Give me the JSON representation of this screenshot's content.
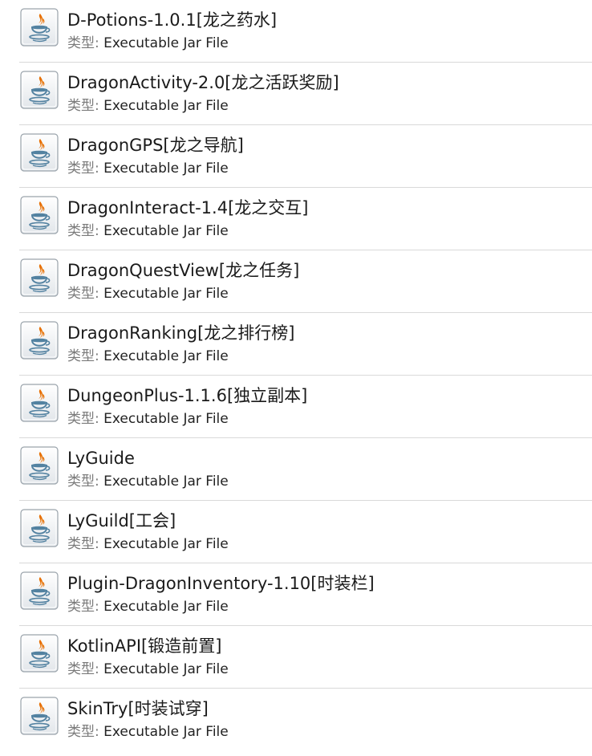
{
  "type_label": "类型:",
  "files": [
    {
      "name": "D-Potions-1.0.1[龙之药水]",
      "type": "Executable Jar File",
      "icon": "java-jar-icon"
    },
    {
      "name": "DragonActivity-2.0[龙之活跃奖励]",
      "type": "Executable Jar File",
      "icon": "java-jar-icon"
    },
    {
      "name": "DragonGPS[龙之导航]",
      "type": "Executable Jar File",
      "icon": "java-jar-icon"
    },
    {
      "name": "DragonInteract-1.4[龙之交互]",
      "type": "Executable Jar File",
      "icon": "java-jar-icon"
    },
    {
      "name": "DragonQuestView[龙之任务]",
      "type": "Executable Jar File",
      "icon": "java-jar-icon"
    },
    {
      "name": "DragonRanking[龙之排行榜]",
      "type": "Executable Jar File",
      "icon": "java-jar-icon"
    },
    {
      "name": "DungeonPlus-1.1.6[独立副本]",
      "type": "Executable Jar File",
      "icon": "java-jar-icon"
    },
    {
      "name": "LyGuide",
      "type": "Executable Jar File",
      "icon": "java-jar-icon"
    },
    {
      "name": "LyGuild[工会]",
      "type": "Executable Jar File",
      "icon": "java-jar-icon"
    },
    {
      "name": "Plugin-DragonInventory-1.10[时装栏]",
      "type": "Executable Jar File",
      "icon": "java-jar-icon"
    },
    {
      "name": "KotlinAPI[锻造前置]",
      "type": "Executable Jar File",
      "icon": "java-jar-icon"
    },
    {
      "name": "SkinTry[时装试穿]",
      "type": "Executable Jar File",
      "icon": "java-jar-icon"
    }
  ]
}
